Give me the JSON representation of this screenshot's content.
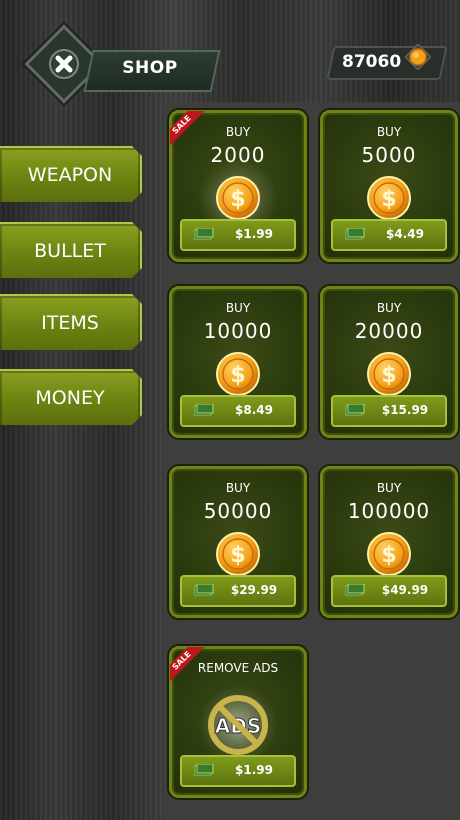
{
  "header": {
    "close_icon": "close-x-icon",
    "shop_label": "SHOP",
    "balance": "87060",
    "balance_icon": "gold-coin-icon"
  },
  "menu": [
    {
      "label": "WEAPON"
    },
    {
      "label": "BULLET"
    },
    {
      "label": "ITEMS"
    },
    {
      "label": "MONEY"
    }
  ],
  "cards": [
    {
      "title": "BUY",
      "amount": "2000",
      "price": "$1.99",
      "sale": "SALE",
      "icon": "dollar-coin-icon"
    },
    {
      "title": "BUY",
      "amount": "5000",
      "price": "$4.49",
      "icon": "dollar-coin-icon"
    },
    {
      "title": "BUY",
      "amount": "10000",
      "price": "$8.49",
      "icon": "dollar-coin-icon"
    },
    {
      "title": "BUY",
      "amount": "20000",
      "price": "$15.99",
      "icon": "dollar-coin-icon"
    },
    {
      "title": "BUY",
      "amount": "50000",
      "price": "$29.99",
      "icon": "dollar-coin-icon"
    },
    {
      "title": "BUY",
      "amount": "100000",
      "price": "$49.99",
      "icon": "dollar-coin-icon"
    },
    {
      "title": "REMOVE ADS",
      "price": "$1.99",
      "sale": "SALE",
      "icon": "no-ads-icon",
      "icon_text": "ADS"
    }
  ],
  "colors": {
    "card_border": "#6e8416",
    "menu_green": "#7a9418",
    "coin_gold": "#f4a11a",
    "sale_red": "#c0161b"
  }
}
